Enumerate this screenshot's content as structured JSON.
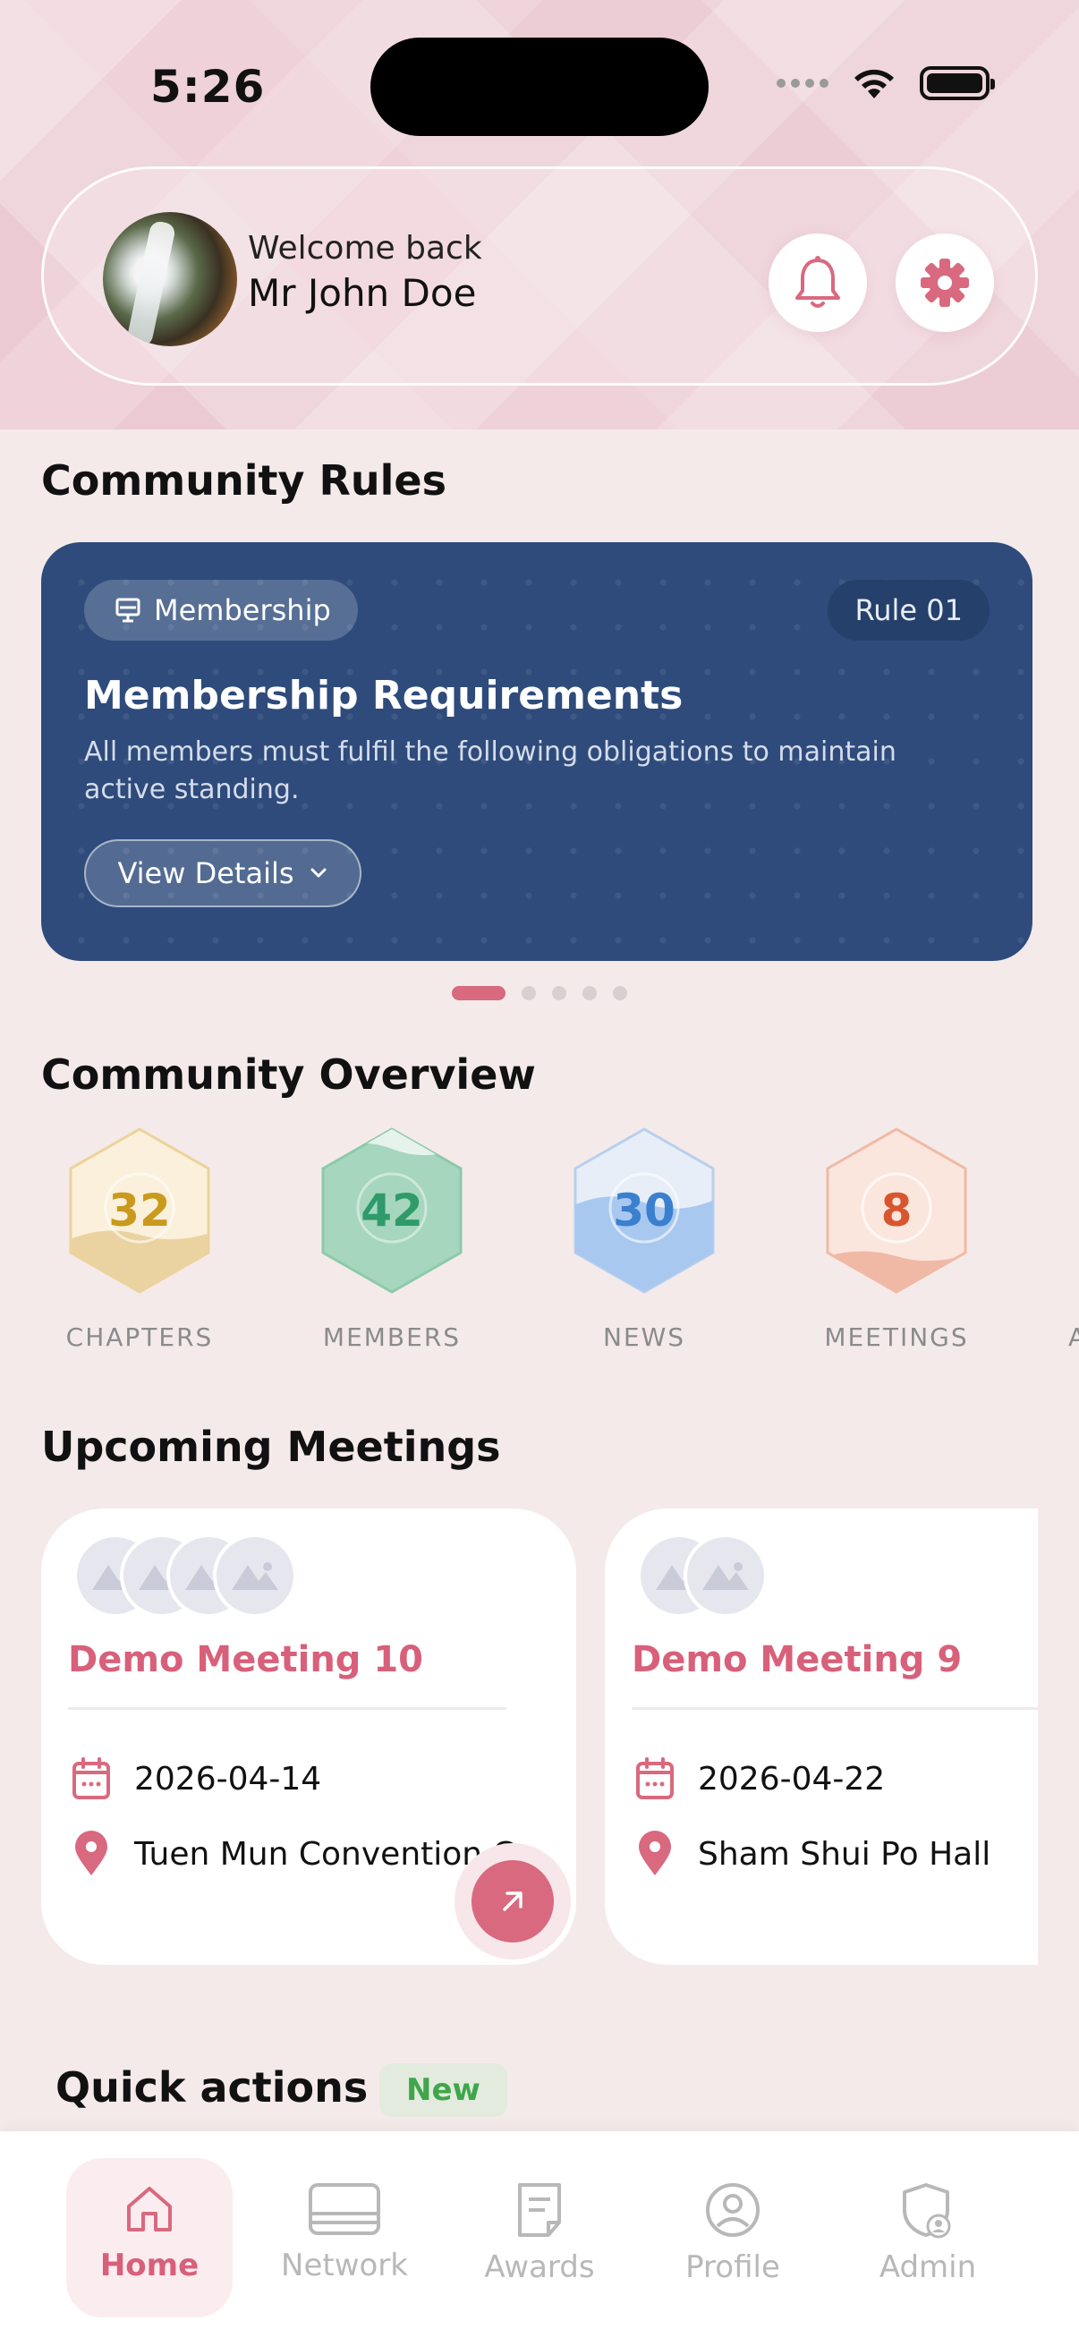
{
  "status_bar": {
    "time": "5:26"
  },
  "header": {
    "welcome": "Welcome back",
    "username": "Mr John Doe",
    "icons": [
      "bell-icon",
      "gear-icon"
    ]
  },
  "rules": {
    "section_title": "Community Rules",
    "card": {
      "category": "Membership",
      "rule_number": "Rule 01",
      "title": "Membership Requirements",
      "description": "All members must fulfil the following obligations to maintain active standing.",
      "details_label": "View Details"
    },
    "pagination": {
      "total": 5,
      "active": 1
    }
  },
  "overview": {
    "section_title": "Community Overview",
    "stats": [
      {
        "value": "32",
        "label": "CHAPTERS",
        "color": "#c99a1e",
        "fill": "#f3e2b8"
      },
      {
        "value": "42",
        "label": "MEMBERS",
        "color": "#2f9a6a",
        "fill": "#a8d8c0"
      },
      {
        "value": "30",
        "label": "NEWS",
        "color": "#3b7fcf",
        "fill": "#b9d3f2"
      },
      {
        "value": "8",
        "label": "MEETINGS",
        "color": "#d8562f",
        "fill": "#f6c9b8"
      }
    ],
    "partial_label": "A"
  },
  "meetings": {
    "section_title": "Upcoming Meetings",
    "items": [
      {
        "title": "Demo Meeting 10",
        "date": "2026-04-14",
        "location": "Tuen Mun Convention C..."
      },
      {
        "title": "Demo Meeting 9",
        "date": "2026-04-22",
        "location": "Sham Shui Po Hall"
      }
    ]
  },
  "quick_actions": {
    "title": "Quick actions",
    "badge": "New"
  },
  "tabbar": {
    "tabs": [
      {
        "label": "Home",
        "icon": "home-icon",
        "active": true
      },
      {
        "label": "Network",
        "icon": "network-icon",
        "active": false
      },
      {
        "label": "Awards",
        "icon": "awards-icon",
        "active": false
      },
      {
        "label": "Profile",
        "icon": "profile-icon",
        "active": false
      },
      {
        "label": "Admin",
        "icon": "admin-icon",
        "active": false
      }
    ]
  },
  "colors": {
    "accent": "#d9697f",
    "rule_card": "#2e4b7b",
    "background": "#f5eaea"
  }
}
